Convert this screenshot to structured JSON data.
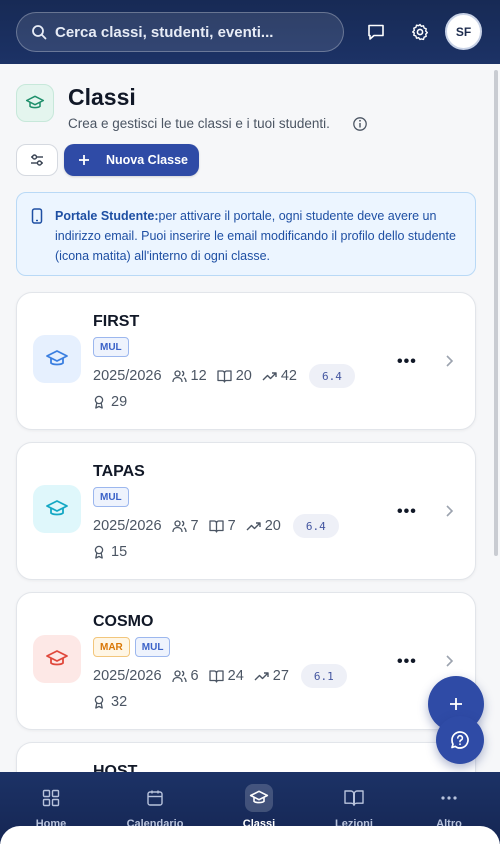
{
  "header": {
    "search_placeholder": "Cerca classi, studenti, eventi...",
    "avatar_initials": "SF"
  },
  "page": {
    "title": "Classi",
    "subtitle": "Crea e gestisci le tue classi e i tuoi studenti.",
    "new_class_label": "Nuova Classe"
  },
  "notice": {
    "bold": "Portale Studente:",
    "text": "per attivare il portale, ogni studente deve avere un indirizzo email. Puoi inserire le email modificando il profilo dello studente (icona matita) all'interno di ogni classe."
  },
  "classes": [
    {
      "name": "FIRST",
      "tags": [
        "MUL"
      ],
      "year": "2025/2026",
      "students": "12",
      "books": "20",
      "trend": "42",
      "grade": "6.4",
      "awards": "29",
      "color": "#3b7fe0",
      "bg": "#e6f0fe"
    },
    {
      "name": "TAPAS",
      "tags": [
        "MUL"
      ],
      "year": "2025/2026",
      "students": "7",
      "books": "7",
      "trend": "20",
      "grade": "6.4",
      "awards": "15",
      "color": "#14a8c4",
      "bg": "#dff7fb"
    },
    {
      "name": "COSMO",
      "tags": [
        "MAR",
        "MUL"
      ],
      "year": "2025/2026",
      "students": "6",
      "books": "24",
      "trend": "27",
      "grade": "6.1",
      "awards": "32",
      "color": "#e0483c",
      "bg": "#fde8e6"
    },
    {
      "name": "HOST"
    }
  ],
  "nav": {
    "items": [
      {
        "label": "Home",
        "icon": "grid-icon"
      },
      {
        "label": "Calendario",
        "icon": "calendar-icon"
      },
      {
        "label": "Classi",
        "icon": "graduation-cap-icon"
      },
      {
        "label": "Lezioni",
        "icon": "book-icon"
      },
      {
        "label": "Altro",
        "icon": "more-icon"
      }
    ],
    "active": "Classi"
  },
  "colors": {
    "primary": "#2f4ba6",
    "header": "#172a55",
    "notice_bg": "#ecf5ff",
    "notice_text": "#1e4fa3"
  }
}
